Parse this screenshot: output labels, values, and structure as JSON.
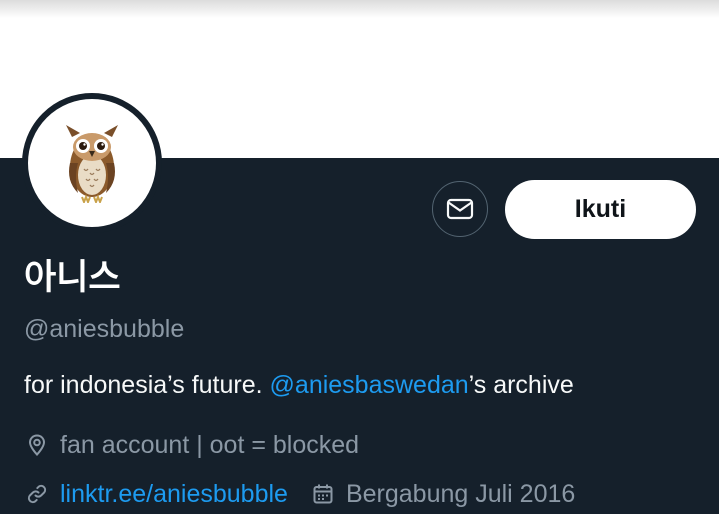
{
  "profile": {
    "display_name": "아니스",
    "handle": "@aniesbubble",
    "bio": {
      "before": "for indonesia’s future. ",
      "mention": "@aniesbaswedan",
      "after": "’s archive"
    },
    "location": "fan account | oot = blocked",
    "website": "linktr.ee/aniesbubble",
    "joined": "Bergabung Juli 2016",
    "avatar_icon": "owl-emoji"
  },
  "actions": {
    "message_icon": "envelope-icon",
    "follow_label": "Ikuti"
  },
  "colors": {
    "background": "#15202b",
    "text_primary": "#f7f9f9",
    "text_secondary": "#8b98a5",
    "link": "#1d9bf0",
    "follow_bg": "#ffffff"
  }
}
